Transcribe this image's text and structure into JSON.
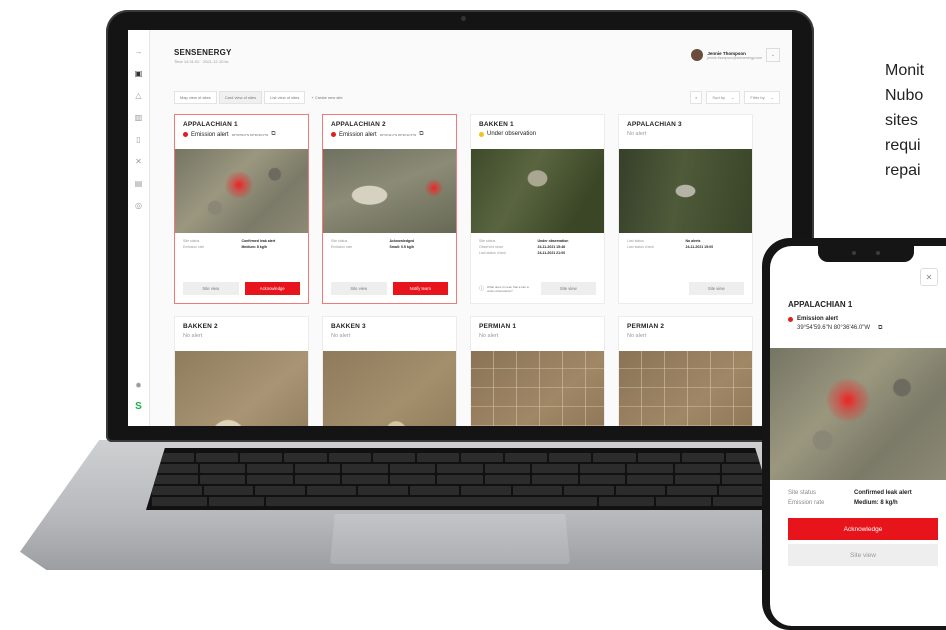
{
  "caption": {
    "lines": [
      "Monit",
      "Nubo",
      "sites",
      "requi",
      "repai"
    ]
  },
  "app": {
    "title": "SENSENERGY",
    "subtitle": "Time 14:31:02 · 2021-12-10 ltc",
    "user": {
      "name": "Jennie Thompson",
      "email": "jennie.thompson@sensenergy.com"
    },
    "view_tabs": [
      "Map view of sites",
      "Card view of sites",
      "List view of sites"
    ],
    "selected_tab": "Card view of sites",
    "create_label": "+ Create new site",
    "sort_label": "Sort by",
    "filter_label": "Filter by"
  },
  "sites": [
    {
      "name": "APPALACHIAN 1",
      "status": "Emission alert",
      "coords": "39°54'59.6\"N 80°36'46.0\"W",
      "details": [
        [
          "Site status",
          "Confirmed leak alert"
        ],
        [
          "Emission rate",
          "Medium: 8 kg/h"
        ]
      ],
      "buttons": [
        "Site view",
        "Acknowledge"
      ]
    },
    {
      "name": "APPALACHIAN 2",
      "status": "Emission alert",
      "coords": "39°54'44.2\"N 80°32'12.5\"W",
      "details": [
        [
          "Site status",
          "Acknowledged"
        ],
        [
          "Emission rate",
          "Small: 0.5 kg/h"
        ]
      ],
      "buttons": [
        "Site view",
        "Notify team"
      ]
    },
    {
      "name": "BAKKEN 1",
      "status": "Under observation",
      "details": [
        [
          "Site status",
          "Under observation"
        ],
        [
          "Observed since",
          "24-11-2021 15:46"
        ],
        [
          "Last status check",
          "24-11-2021 21:00"
        ]
      ],
      "info": "What does it mean that a site is under observation?",
      "buttons": [
        "Site view"
      ]
    },
    {
      "name": "APPALACHIAN 3",
      "status": "No alert",
      "details": [
        [
          "Last status",
          "No alerts"
        ],
        [
          "Last status check",
          "24-11-2021 15:00"
        ]
      ],
      "buttons": [
        "Site view"
      ]
    },
    {
      "name": "BAKKEN 2",
      "status": "No alert"
    },
    {
      "name": "BAKKEN 3",
      "status": "No alert"
    },
    {
      "name": "PERMIAN 1",
      "status": "No alert"
    },
    {
      "name": "PERMIAN 2",
      "status": "No alert"
    }
  ],
  "phone": {
    "site": "APPALACHIAN 1",
    "status": "Emission alert",
    "coords": "39°54'59.6\"N 80°36'46.0\"W",
    "details": [
      [
        "Site status",
        "Confirmed leak alert"
      ],
      [
        "Emission rate",
        "Medium: 8 kg/h"
      ]
    ],
    "primary_button": "Acknowledge",
    "secondary_button": "Site view"
  },
  "colors": {
    "alert_red": "#e8141c",
    "observe_yellow": "#f4c322",
    "brand_green": "#18b44a"
  },
  "icons": [
    "collapse-arrow-icon",
    "dashboard-icon",
    "bell-icon",
    "buildings-icon",
    "document-icon",
    "drone-icon",
    "report-icon",
    "help-icon",
    "settings-icon",
    "brand-logo-icon",
    "search-icon",
    "copy-icon",
    "close-icon",
    "info-icon"
  ]
}
